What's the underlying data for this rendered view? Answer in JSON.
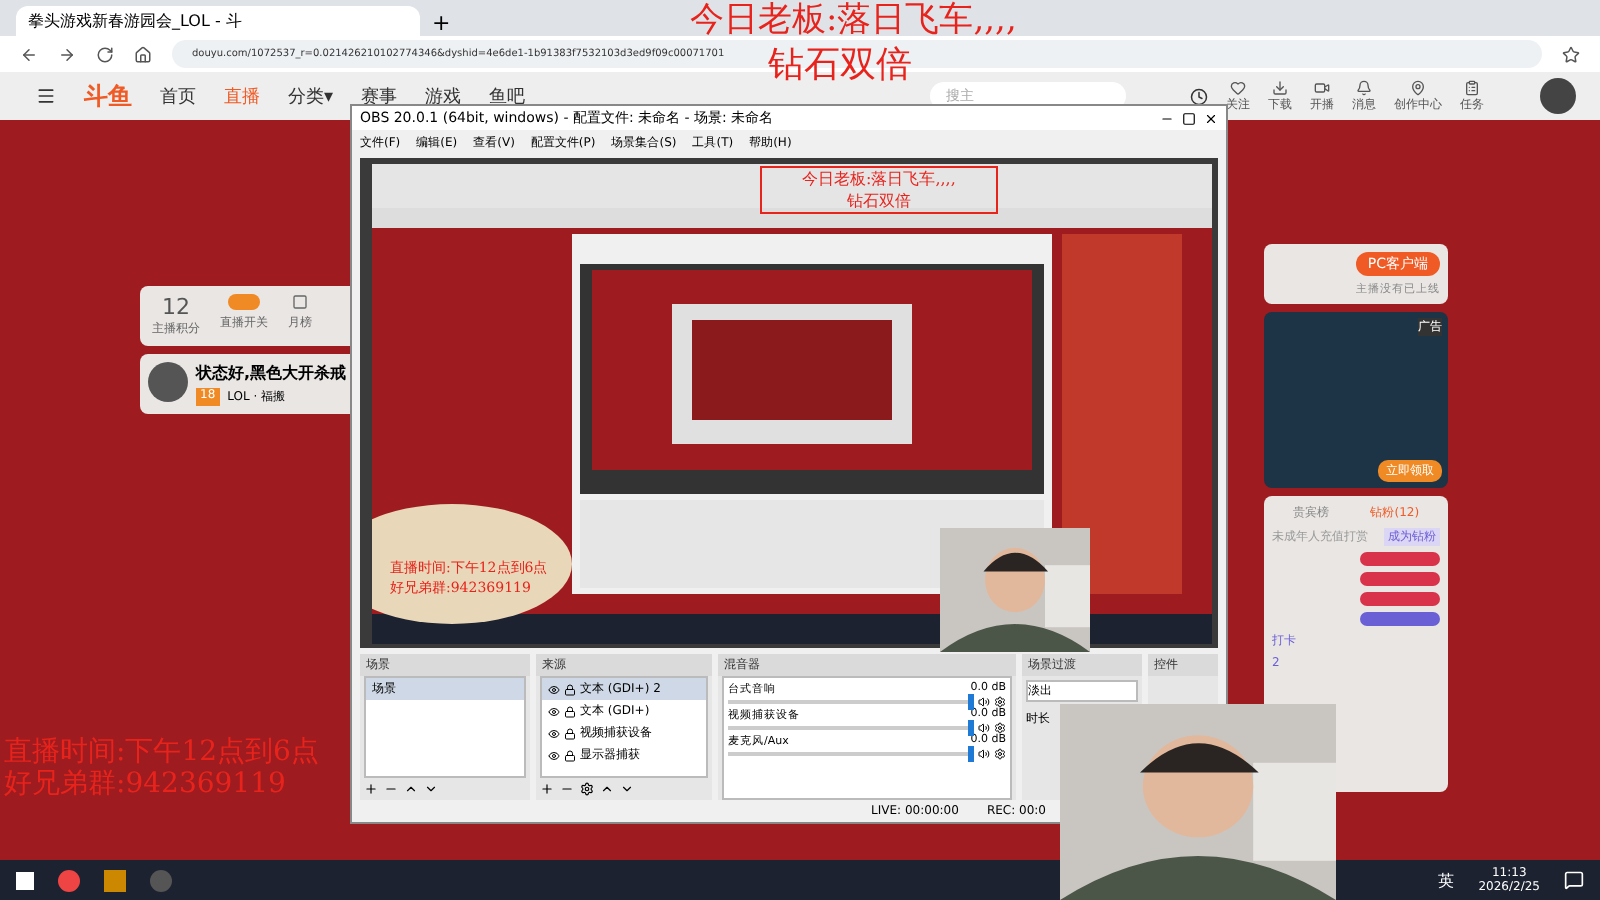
{
  "browser": {
    "tab_title": "拳头游戏新春游园会_LOL - 斗",
    "new_tab": "+",
    "url": "douyu.com/1072537_r=0.021426210102774346&dyshid=4e6de1-1b91383f7532103d3ed9f09c00071701"
  },
  "overlay_text": [
    "今日老板:落日飞车,,,,",
    "钻石双倍"
  ],
  "site_nav": {
    "logo": "斗鱼",
    "links": [
      {
        "label": "首页",
        "selected": false
      },
      {
        "label": "直播",
        "selected": true
      },
      {
        "label": "分类▾",
        "selected": false
      },
      {
        "label": "赛事",
        "selected": false
      },
      {
        "label": "游戏",
        "selected": false
      },
      {
        "label": "鱼吧",
        "selected": false
      }
    ],
    "search": {
      "placeholder": "搜主"
    },
    "actions": [
      "关注",
      "下载",
      "开播",
      "消息",
      "创作中心",
      "任务"
    ]
  },
  "streamer_card": {
    "score": "12",
    "score_label": "主播积分",
    "toggle_label": "直播开关",
    "toggle_on": true,
    "rank_label": "月榜",
    "title": "状态好,黑色大开杀戒",
    "level": "18",
    "category": "LOL · 福搬"
  },
  "right_panel": {
    "client_button": "PC客户端",
    "client_note": "主播没有已上线",
    "ad_label": "广告",
    "ad_button": "立即领取",
    "tabs": [
      {
        "label": "贵宾榜",
        "selected": false
      },
      {
        "label": "钻粉(12)",
        "selected": true
      }
    ],
    "notice": "未成年人充值打赏",
    "join_button": "成为钻粉",
    "fans": [
      {
        "color": "#d8334a"
      },
      {
        "color": "#d8334a"
      },
      {
        "color": "#d8334a"
      },
      {
        "color": "#6b5fd6"
      }
    ],
    "chat": [
      "打卡",
      "2"
    ]
  },
  "obs": {
    "title": "OBS 20.0.1 (64bit, windows) - 配置文件: 未命名 - 场景: 未命名",
    "menu": [
      "文件(F)",
      "编辑(E)",
      "查看(V)",
      "配置文件(P)",
      "场景集合(S)",
      "工具(T)",
      "帮助(H)"
    ],
    "preview": {
      "overlay_text": [
        "今日老板:落日飞车,,,,",
        "钻石双倍"
      ],
      "schedule_text": [
        "直播时间:下午12点到6点",
        "好兄弟群:942369119"
      ]
    },
    "scenes": {
      "title": "场景",
      "items": [
        {
          "label": "场景",
          "selected": true
        }
      ]
    },
    "sources": {
      "title": "来源",
      "items": [
        {
          "label": "文本 (GDI+) 2",
          "selected": true
        },
        {
          "label": "文本 (GDI+)",
          "selected": false
        },
        {
          "label": "视频捕获设备",
          "selected": false
        },
        {
          "label": "显示器捕获",
          "selected": false
        }
      ]
    },
    "mixer": {
      "title": "混音器",
      "channels": [
        {
          "name": "台式音响",
          "reading": "0.0 dB",
          "level": 1
        },
        {
          "name": "视频捕获设备",
          "reading": "0.0 dB",
          "level": 1
        },
        {
          "name": "麦克风/Aux",
          "reading": "0.0 dB",
          "level": 1
        }
      ]
    },
    "transitions": {
      "title": "场景过渡",
      "value": "淡出",
      "duration_label": "时长"
    },
    "controls": {
      "title": "控件"
    },
    "status": {
      "live": "LIVE: 00:00:00",
      "rec": "REC: 00:0"
    }
  },
  "schedule_text": [
    "直播时间:下午12点到6点",
    "好兄弟群:942369119"
  ],
  "taskbar": {
    "ime": "英",
    "time": "11:13",
    "date": "2026/2/25"
  }
}
